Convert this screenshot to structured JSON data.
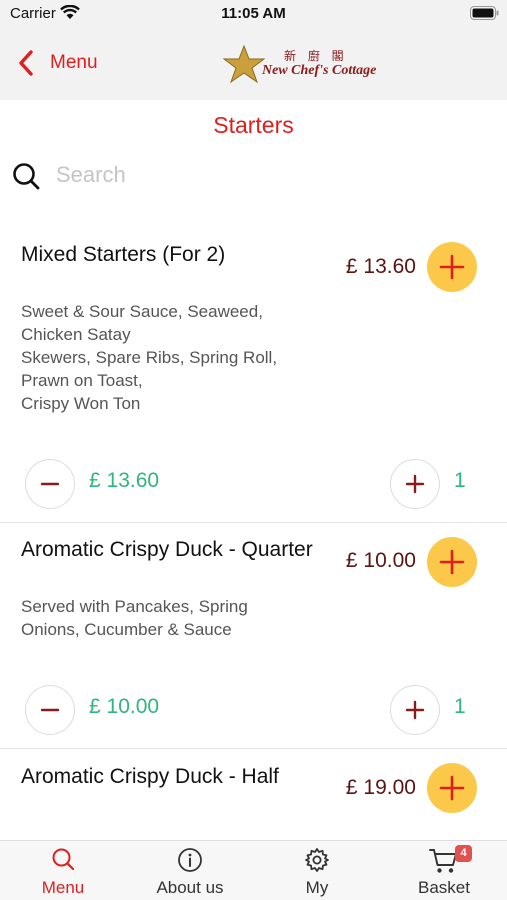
{
  "status_bar": {
    "carrier": "Carrier",
    "time": "11:05 AM"
  },
  "nav": {
    "back_label": "Menu",
    "logo_chinese": "新 廚 閣",
    "logo_text": "New Chef's Cottage"
  },
  "section_title": "Starters",
  "search": {
    "placeholder": "Search",
    "value": ""
  },
  "items": [
    {
      "name": "Mixed Starters (For 2)",
      "price": "£ 13.60",
      "description_lines": [
        "Sweet & Sour Sauce, Seaweed,",
        "Chicken Satay",
        "Skewers, Spare Ribs, Spring Roll,",
        "Prawn on Toast,",
        "Crispy Won Ton"
      ],
      "total": "£ 13.60",
      "quantity": "1"
    },
    {
      "name": "Aromatic Crispy Duck - Quarter",
      "price": "£ 10.00",
      "description_lines": [
        "Served with Pancakes, Spring",
        "Onions, Cucumber & Sauce"
      ],
      "total": "£ 10.00",
      "quantity": "1"
    },
    {
      "name": "Aromatic Crispy Duck - Half",
      "price": "£ 19.00",
      "description_lines": [],
      "total": "",
      "quantity": ""
    }
  ],
  "tabs": [
    {
      "label": "Menu",
      "icon": "search-icon",
      "active": true
    },
    {
      "label": "About us",
      "icon": "info-icon",
      "active": false
    },
    {
      "label": "My",
      "icon": "gear-icon",
      "active": false
    },
    {
      "label": "Basket",
      "icon": "cart-icon",
      "active": false,
      "badge": "4"
    }
  ],
  "colors": {
    "accent": "#e01e1e",
    "add_button": "#fbc84a",
    "price": "#5a1414",
    "total_green": "#2fb57e",
    "chrome_bg": "#f2f2f2"
  }
}
